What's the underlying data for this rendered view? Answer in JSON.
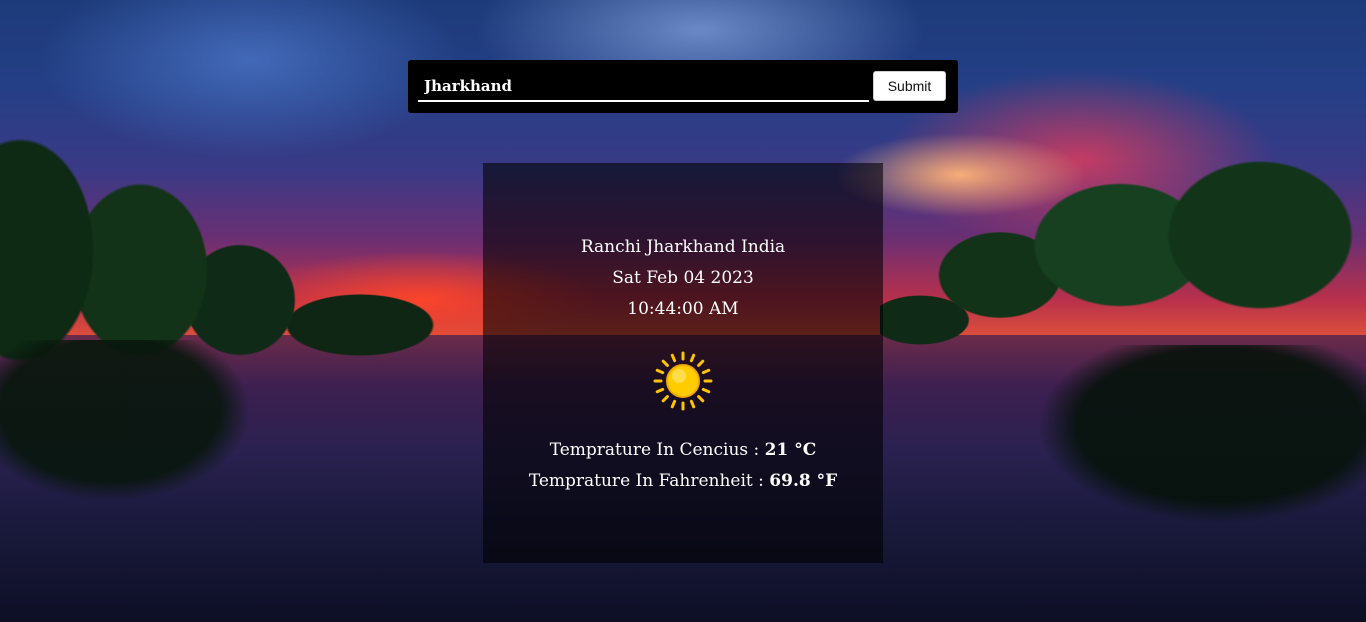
{
  "search": {
    "value": "Jharkhand",
    "submit_label": "Submit"
  },
  "weather": {
    "location": "Ranchi Jharkhand India",
    "date": "Sat Feb 04 2023",
    "time": "10:44:00 AM",
    "icon": "sun-icon",
    "celsius_label": "Temprature In Cencius : ",
    "celsius_value": "21 °C",
    "fahrenheit_label": "Temprature In Fahrenheit : ",
    "fahrenheit_value": "69.8 °F"
  },
  "colors": {
    "search_bg": "#000000",
    "card_bg": "rgba(0,0,0,0.58)",
    "text": "#ffffff",
    "sun": "#ffc400"
  }
}
